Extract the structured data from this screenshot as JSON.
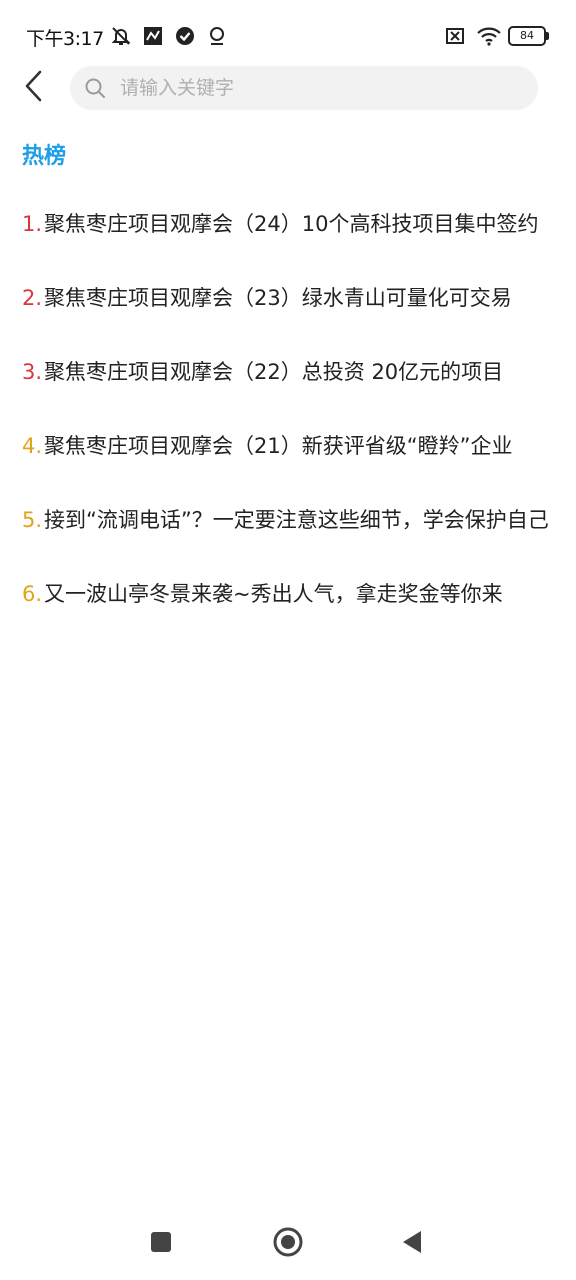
{
  "status_bar": {
    "time": "下午3:17",
    "battery": "84",
    "icons_left": [
      "mute-bell-icon",
      "app-notification-icon",
      "check-badge-icon",
      "location-icon"
    ],
    "icons_right": [
      "no-sim-icon",
      "wifi-icon",
      "battery-icon"
    ]
  },
  "header": {
    "back_icon": "chevron-left-icon",
    "search_placeholder": "请输入关键字",
    "search_value": ""
  },
  "hot": {
    "title": "热榜",
    "items": [
      {
        "rank": "1.",
        "text": "聚焦枣庄项目观摩会（24）10个高科技项目集中签约",
        "rank_color": "#d9363e"
      },
      {
        "rank": "2.",
        "text": "聚焦枣庄项目观摩会（23）绿水青山可量化可交易",
        "rank_color": "#d9363e"
      },
      {
        "rank": "3.",
        "text": "聚焦枣庄项目观摩会（22）总投资  20亿元的项目",
        "rank_color": "#d9363e"
      },
      {
        "rank": "4.",
        "text": "聚焦枣庄项目观摩会（21）新获评省级“瞪羚”企业",
        "rank_color": "#e3a21a"
      },
      {
        "rank": "5.",
        "text": "接到“流调电话”？一定要注意这些细节，学会保护自己",
        "rank_color": "#e3a21a"
      },
      {
        "rank": "6.",
        "text": "又一波山亭冬景来袭~秀出人气，拿走奖金等你来",
        "rank_color": "#e3a21a"
      }
    ]
  },
  "nav_bar": {
    "items": [
      "recents-square-icon",
      "home-circle-icon",
      "back-triangle-icon"
    ]
  }
}
